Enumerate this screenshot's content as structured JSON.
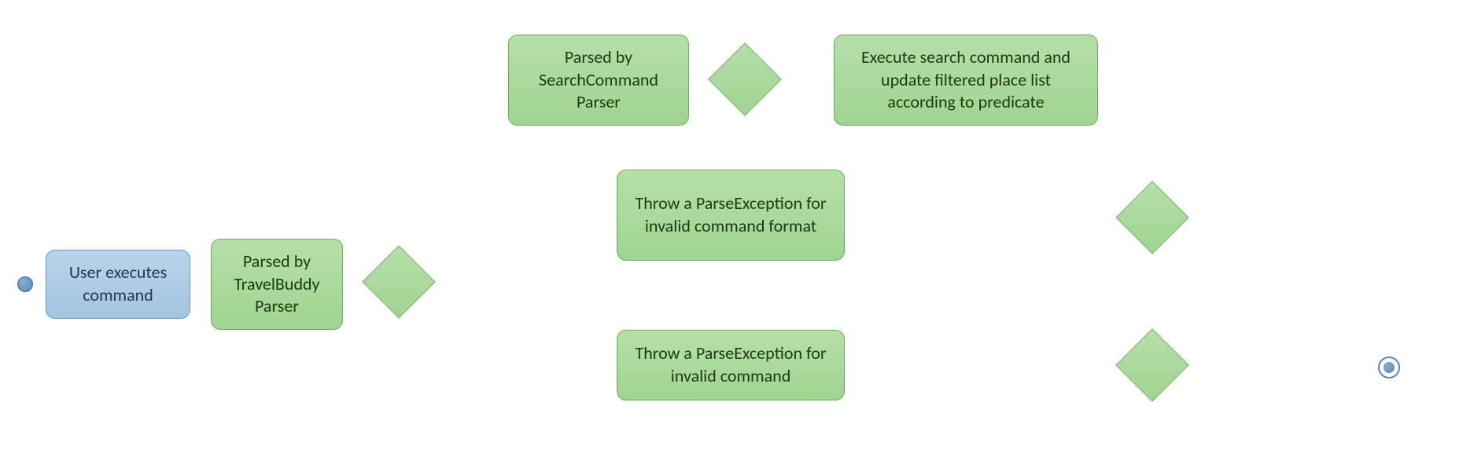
{
  "diagram": {
    "nodes": {
      "user_executes": "User executes command",
      "parsed_travelbuddy": "Parsed by TravelBuddy Parser",
      "parsed_searchcommand": "Parsed by SearchCommand Parser",
      "throw_invalid_format": "Throw a ParseException for invalid command format",
      "throw_invalid_command": "Throw a ParseException for invalid command",
      "execute_search": "Execute search command and update filtered place list according to predicate"
    }
  }
}
